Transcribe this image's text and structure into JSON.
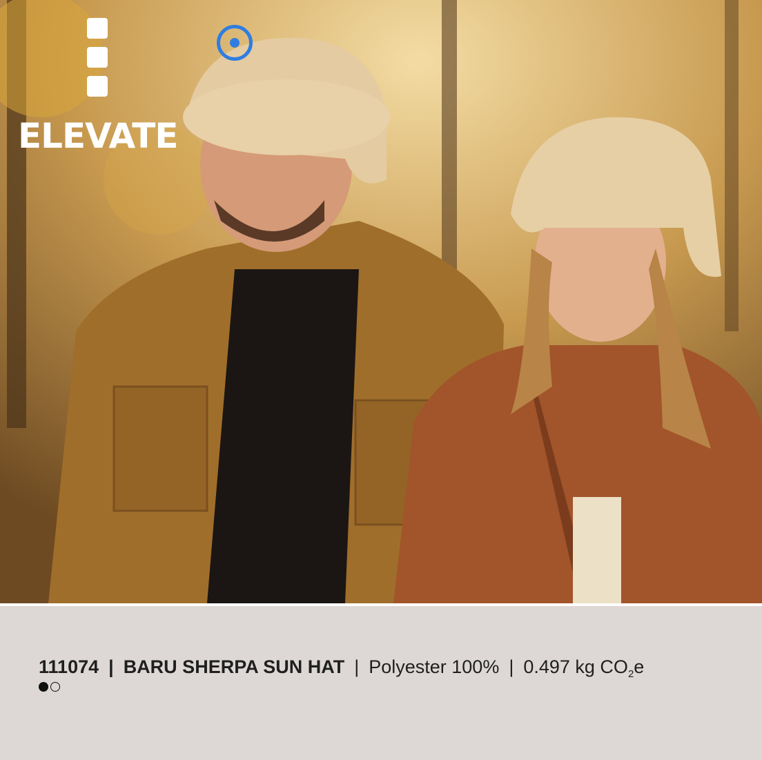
{
  "brand": {
    "name": "ELEVATE",
    "accent_color": "#2f7de1"
  },
  "photo": {
    "icon": "product-lifestyle-photo"
  },
  "product": {
    "code": "111074",
    "name": "BARU SHERPA SUN HAT",
    "material": "Polyester 100%",
    "co2_value": "0.497 kg CO",
    "co2_sub": "2",
    "co2_suffix": "e",
    "separator": "|"
  },
  "pagination": {
    "current": 1,
    "total": 2
  }
}
